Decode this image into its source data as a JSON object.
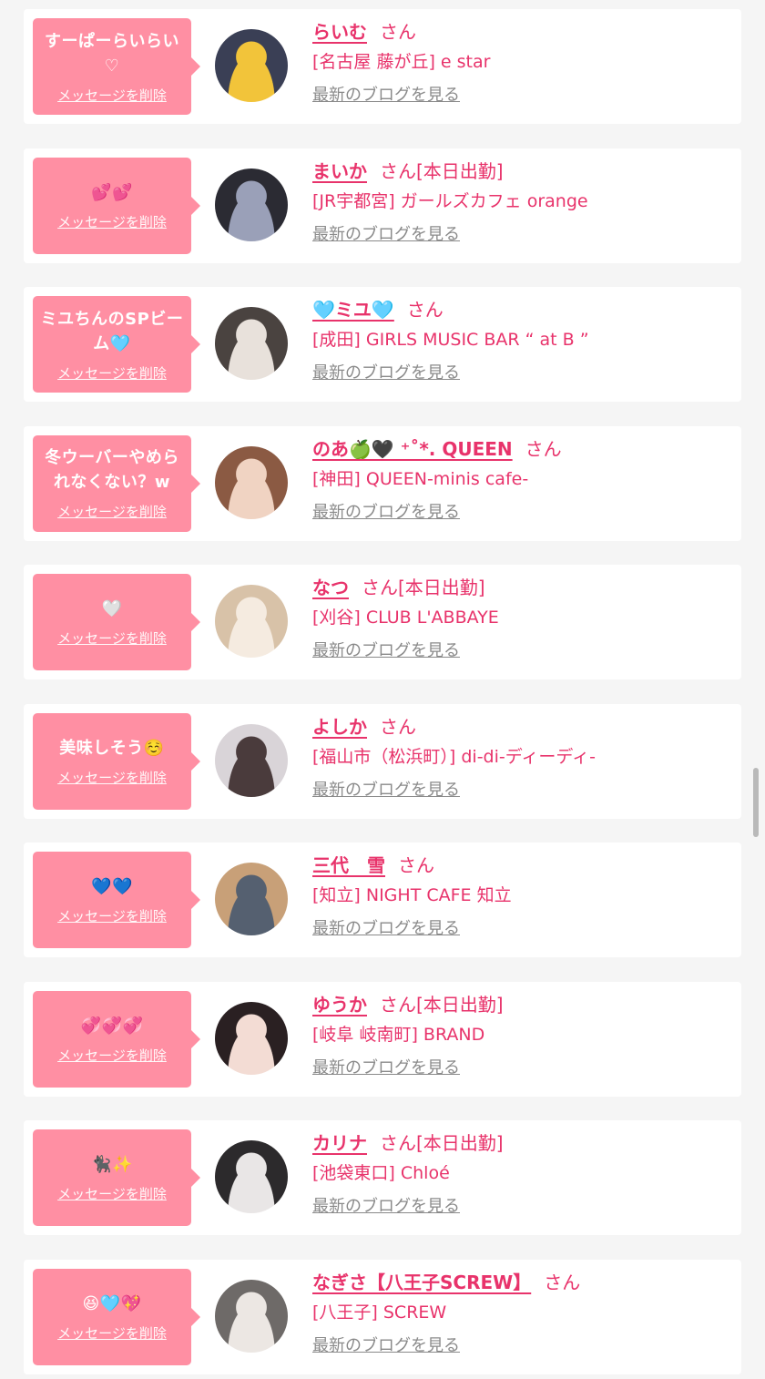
{
  "colors": {
    "accent": "#e8336b",
    "bubble": "#ff8fa3",
    "background": "#f5f5f5",
    "link_gray": "#8a8a8a"
  },
  "labels": {
    "delete_message": "メッセージを削除",
    "honorific": "さん",
    "latest_blog": "最新のブログを見る"
  },
  "items": [
    {
      "message": "すーぱーらいらい♡",
      "name": "らいむ",
      "badge": "",
      "shop": "[名古屋 藤が丘] e star",
      "avatar_colors": [
        "#3a3f55",
        "#f2c43a"
      ]
    },
    {
      "message": "💕💕",
      "name": "まいか",
      "badge": "[本日出勤]",
      "shop": "[JR宇都宮] ガールズカフェ orange",
      "avatar_colors": [
        "#2b2b33",
        "#9aa0b8"
      ]
    },
    {
      "message": "ミユちんのSPビーム🩵",
      "name": "🩵ミユ🩵",
      "badge": "",
      "shop": "[成田] GIRLS MUSIC BAR “ at B ”",
      "avatar_colors": [
        "#4a4340",
        "#e8e1db"
      ]
    },
    {
      "message": "冬ウーバーやめられなくない？w",
      "name": "のあ🍏🖤 ⁺˚*. QUEEN",
      "badge": "",
      "shop": "[神田] QUEEN-minis cafe-",
      "avatar_colors": [
        "#8b5a43",
        "#f0d3c2"
      ]
    },
    {
      "message": "🤍",
      "name": "なつ",
      "badge": "[本日出勤]",
      "shop": "[刈谷] CLUB L'ABBAYE",
      "avatar_colors": [
        "#d8c2a8",
        "#f5ebe0"
      ]
    },
    {
      "message": "美味しそう☺️",
      "name": "よしか",
      "badge": "",
      "shop": "[福山市（松浜町）] di-di-ディーディ-",
      "avatar_colors": [
        "#d9d4d8",
        "#4a3b3c"
      ]
    },
    {
      "message": "💙💙",
      "name": "三代　雪",
      "badge": "",
      "shop": "[知立] NIGHT CAFE 知立",
      "avatar_colors": [
        "#c8a078",
        "#556070"
      ]
    },
    {
      "message": "💞💞💞",
      "name": "ゆうか",
      "badge": "[本日出勤]",
      "shop": "[岐阜 岐南町] BRAND",
      "avatar_colors": [
        "#2a2022",
        "#f3dcd4"
      ]
    },
    {
      "message": "🐈‍⬛✨",
      "name": "カリナ",
      "badge": "[本日出勤]",
      "shop": "[池袋東口] Chloé",
      "avatar_colors": [
        "#2c2a2c",
        "#e9e6e6"
      ]
    },
    {
      "message": "😆🩵💖",
      "name": "なぎさ【八王子SCREW】",
      "badge": "",
      "shop": "[八王子] SCREW",
      "avatar_colors": [
        "#6e6a68",
        "#ece7e3"
      ]
    }
  ]
}
